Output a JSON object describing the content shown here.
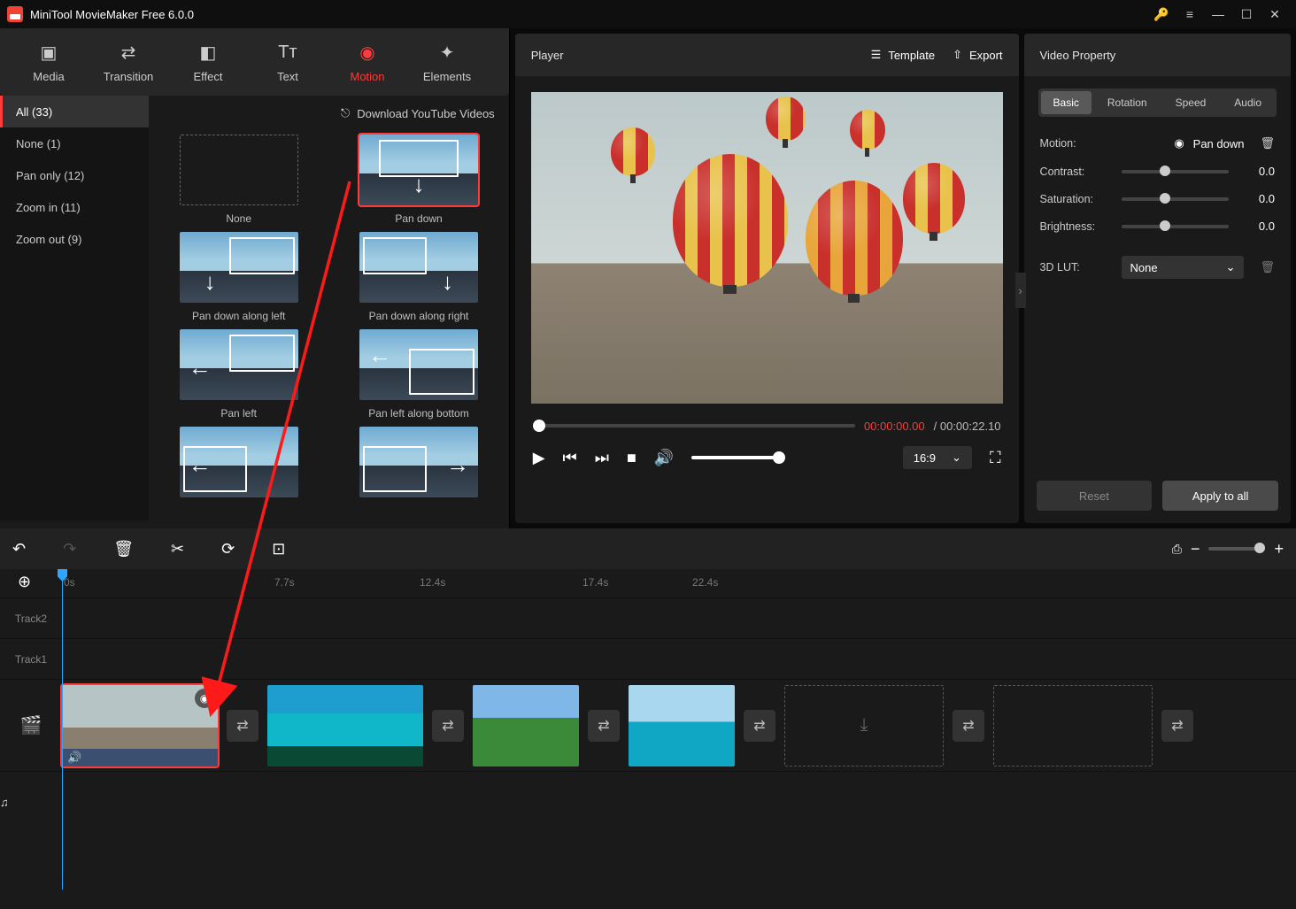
{
  "title": "MiniTool MovieMaker Free 6.0.0",
  "toolbar": {
    "media": "Media",
    "transition": "Transition",
    "effect": "Effect",
    "text": "Text",
    "motion": "Motion",
    "elements": "Elements"
  },
  "categories": {
    "all": "All (33)",
    "none": "None (1)",
    "panonly": "Pan only (12)",
    "zoomin": "Zoom in (11)",
    "zoomout": "Zoom out (9)"
  },
  "download_yt": "Download YouTube Videos",
  "grid": {
    "none": "None",
    "pan_down": "Pan down",
    "pan_down_left": "Pan down along left",
    "pan_down_right": "Pan down along right",
    "pan_left": "Pan left",
    "pan_left_bottom": "Pan left along bottom"
  },
  "player": {
    "title": "Player",
    "template": "Template",
    "export": "Export",
    "time_current": "00:00:00.00",
    "time_total": "/ 00:00:22.10",
    "ratio": "16:9"
  },
  "props": {
    "title": "Video Property",
    "tab_basic": "Basic",
    "tab_rotation": "Rotation",
    "tab_speed": "Speed",
    "tab_audio": "Audio",
    "motion_label": "Motion:",
    "motion_value": "Pan down",
    "contrast": "Contrast:",
    "saturation": "Saturation:",
    "brightness": "Brightness:",
    "lut": "3D LUT:",
    "lut_value": "None",
    "zero": "0.0",
    "reset": "Reset",
    "apply": "Apply to all"
  },
  "timeline": {
    "t0": "0s",
    "t1": "7.7s",
    "t2": "12.4s",
    "t3": "17.4s",
    "t4": "22.4s",
    "track2": "Track2",
    "track1": "Track1"
  }
}
